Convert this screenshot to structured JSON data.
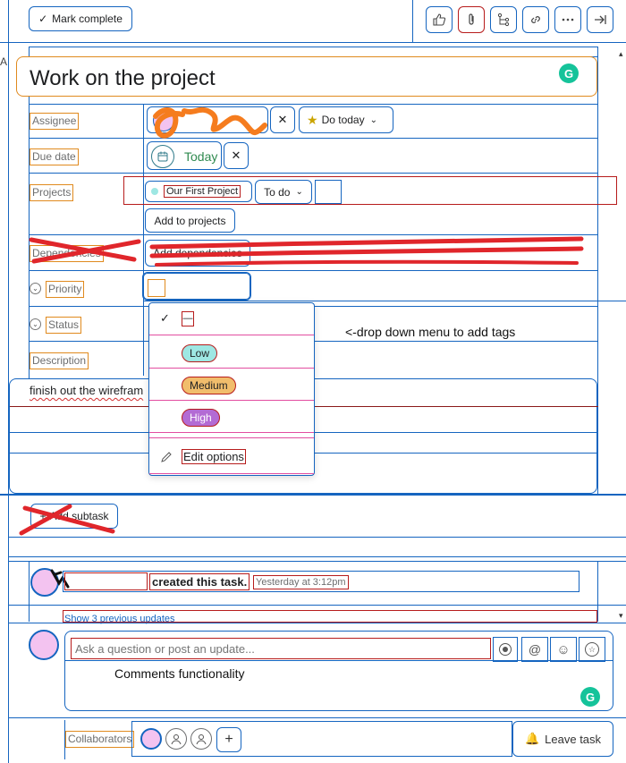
{
  "header": {
    "mark_complete": "Mark complete"
  },
  "task": {
    "title": "Work on the project",
    "grammarly_badge": "G"
  },
  "fields": {
    "assignee_label": "Assignee",
    "do_today": "Do today",
    "due_date_label": "Due date",
    "due_date_value": "Today",
    "projects_label": "Projects",
    "project_name": "Our First Project",
    "project_section": "To do",
    "add_to_projects": "Add to projects",
    "dependencies_label": "Dependencies",
    "add_dependencies": "Add dependencies",
    "priority_label": "Priority",
    "status_label": "Status",
    "description_label": "Description",
    "description_text": "finish out the wirefram"
  },
  "dropdown": {
    "options": [
      {
        "label": "—",
        "color": "#ffffff"
      },
      {
        "label": "Low",
        "color": "#9ee7e3"
      },
      {
        "label": "Medium",
        "color": "#f1bd6c"
      },
      {
        "label": "High",
        "color": "#b36bd4"
      }
    ],
    "edit_options": "Edit options"
  },
  "annotations": {
    "dropdown_note": "<-drop down menu to add tags",
    "comments_note": "Comments functionality"
  },
  "subtask": {
    "add_subtask": "Add subtask"
  },
  "activity": {
    "created_text": "created this task.",
    "timestamp": "Yesterday at 3:12pm",
    "show_previous": "Show 3 previous updates"
  },
  "comment": {
    "placeholder": "Ask a question or post an update..."
  },
  "footer": {
    "collaborators_label": "Collaborators",
    "leave_task": "Leave task"
  },
  "colors": {
    "accent_blue": "#1565c0",
    "annotation_red": "#e0262b",
    "grammarly_green": "#15c39a",
    "today_green": "#2f8a4f"
  }
}
